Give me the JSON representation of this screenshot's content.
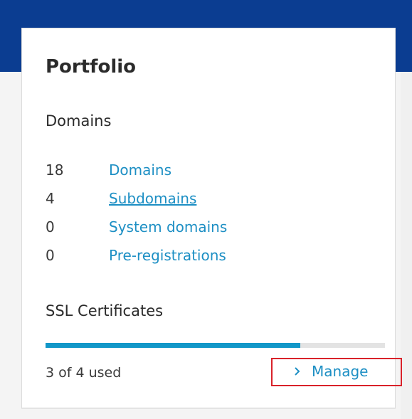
{
  "portfolio": {
    "title": "Portfolio",
    "domains_section": {
      "title": "Domains",
      "items": [
        {
          "count": "18",
          "label": "Domains"
        },
        {
          "count": "4",
          "label": "Subdomains"
        },
        {
          "count": "0",
          "label": "System domains"
        },
        {
          "count": "0",
          "label": "Pre-registrations"
        }
      ]
    },
    "ssl_section": {
      "title": "SSL Certificates",
      "used": 3,
      "total": 4,
      "usage_text": "3 of 4 used",
      "usage_fraction": 0.75,
      "manage_label": "Manage"
    }
  },
  "colors": {
    "header_band": "#0b3d91",
    "link": "#1d8fc4",
    "progress_fill": "#1297c8",
    "progress_track": "#e3e3e3",
    "highlight_border": "#d9222a"
  },
  "icons": {
    "manage": "chevron-right-icon"
  }
}
